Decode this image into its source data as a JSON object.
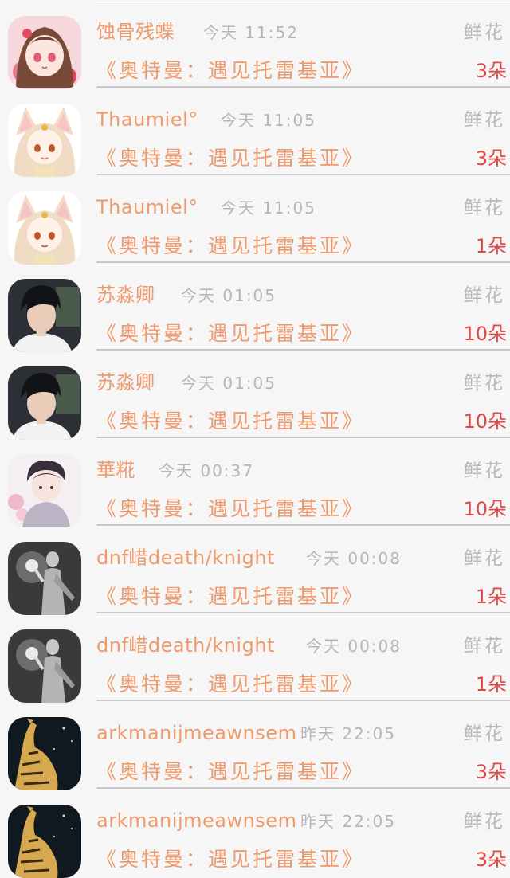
{
  "gift_label": "鲜花",
  "book_title": "《奥特曼：遇见托雷基亚》",
  "records": [
    {
      "user": "蚀骨残蝶",
      "time": "今天  11:52",
      "count": "3朵",
      "avatar": "anime-girl-avatar"
    },
    {
      "user": "Thaumiel°",
      "time": "今天  11:05",
      "count": "3朵",
      "avatar": "cat-ear-girl-avatar"
    },
    {
      "user": "Thaumiel°",
      "time": "今天  11:05",
      "count": "1朵",
      "avatar": "cat-ear-girl-avatar"
    },
    {
      "user": "苏淼卿",
      "time": "今天  01:05",
      "count": "10朵",
      "avatar": "young-man-avatar"
    },
    {
      "user": "苏淼卿",
      "time": "今天  01:05",
      "count": "10朵",
      "avatar": "young-man-avatar"
    },
    {
      "user": "華糀",
      "time": "今天  00:37",
      "count": "10朵",
      "avatar": "sketch-boy-avatar"
    },
    {
      "user": "dnf㟙death/knight",
      "time": "今天  00:08",
      "count": "1朵",
      "avatar": "grey-figure-avatar"
    },
    {
      "user": "dnf㟙death/knight",
      "time": "今天  00:08",
      "count": "1朵",
      "avatar": "grey-figure-avatar"
    },
    {
      "user": "arkmanijmeawnsem",
      "time": "昨天  22:05",
      "count": "3朵",
      "avatar": "tiger-avatar"
    },
    {
      "user": "arkmanijmeawnsem",
      "time": "昨天  22:05",
      "count": "3朵",
      "avatar": "tiger-avatar"
    }
  ],
  "colors": {
    "background": "#f7f6f6",
    "username": "#ef9a6d",
    "book_title": "#ef9a6d",
    "muted_text": "#b6b6b6",
    "count": "#e04848",
    "divider": "#c8c8c8"
  }
}
